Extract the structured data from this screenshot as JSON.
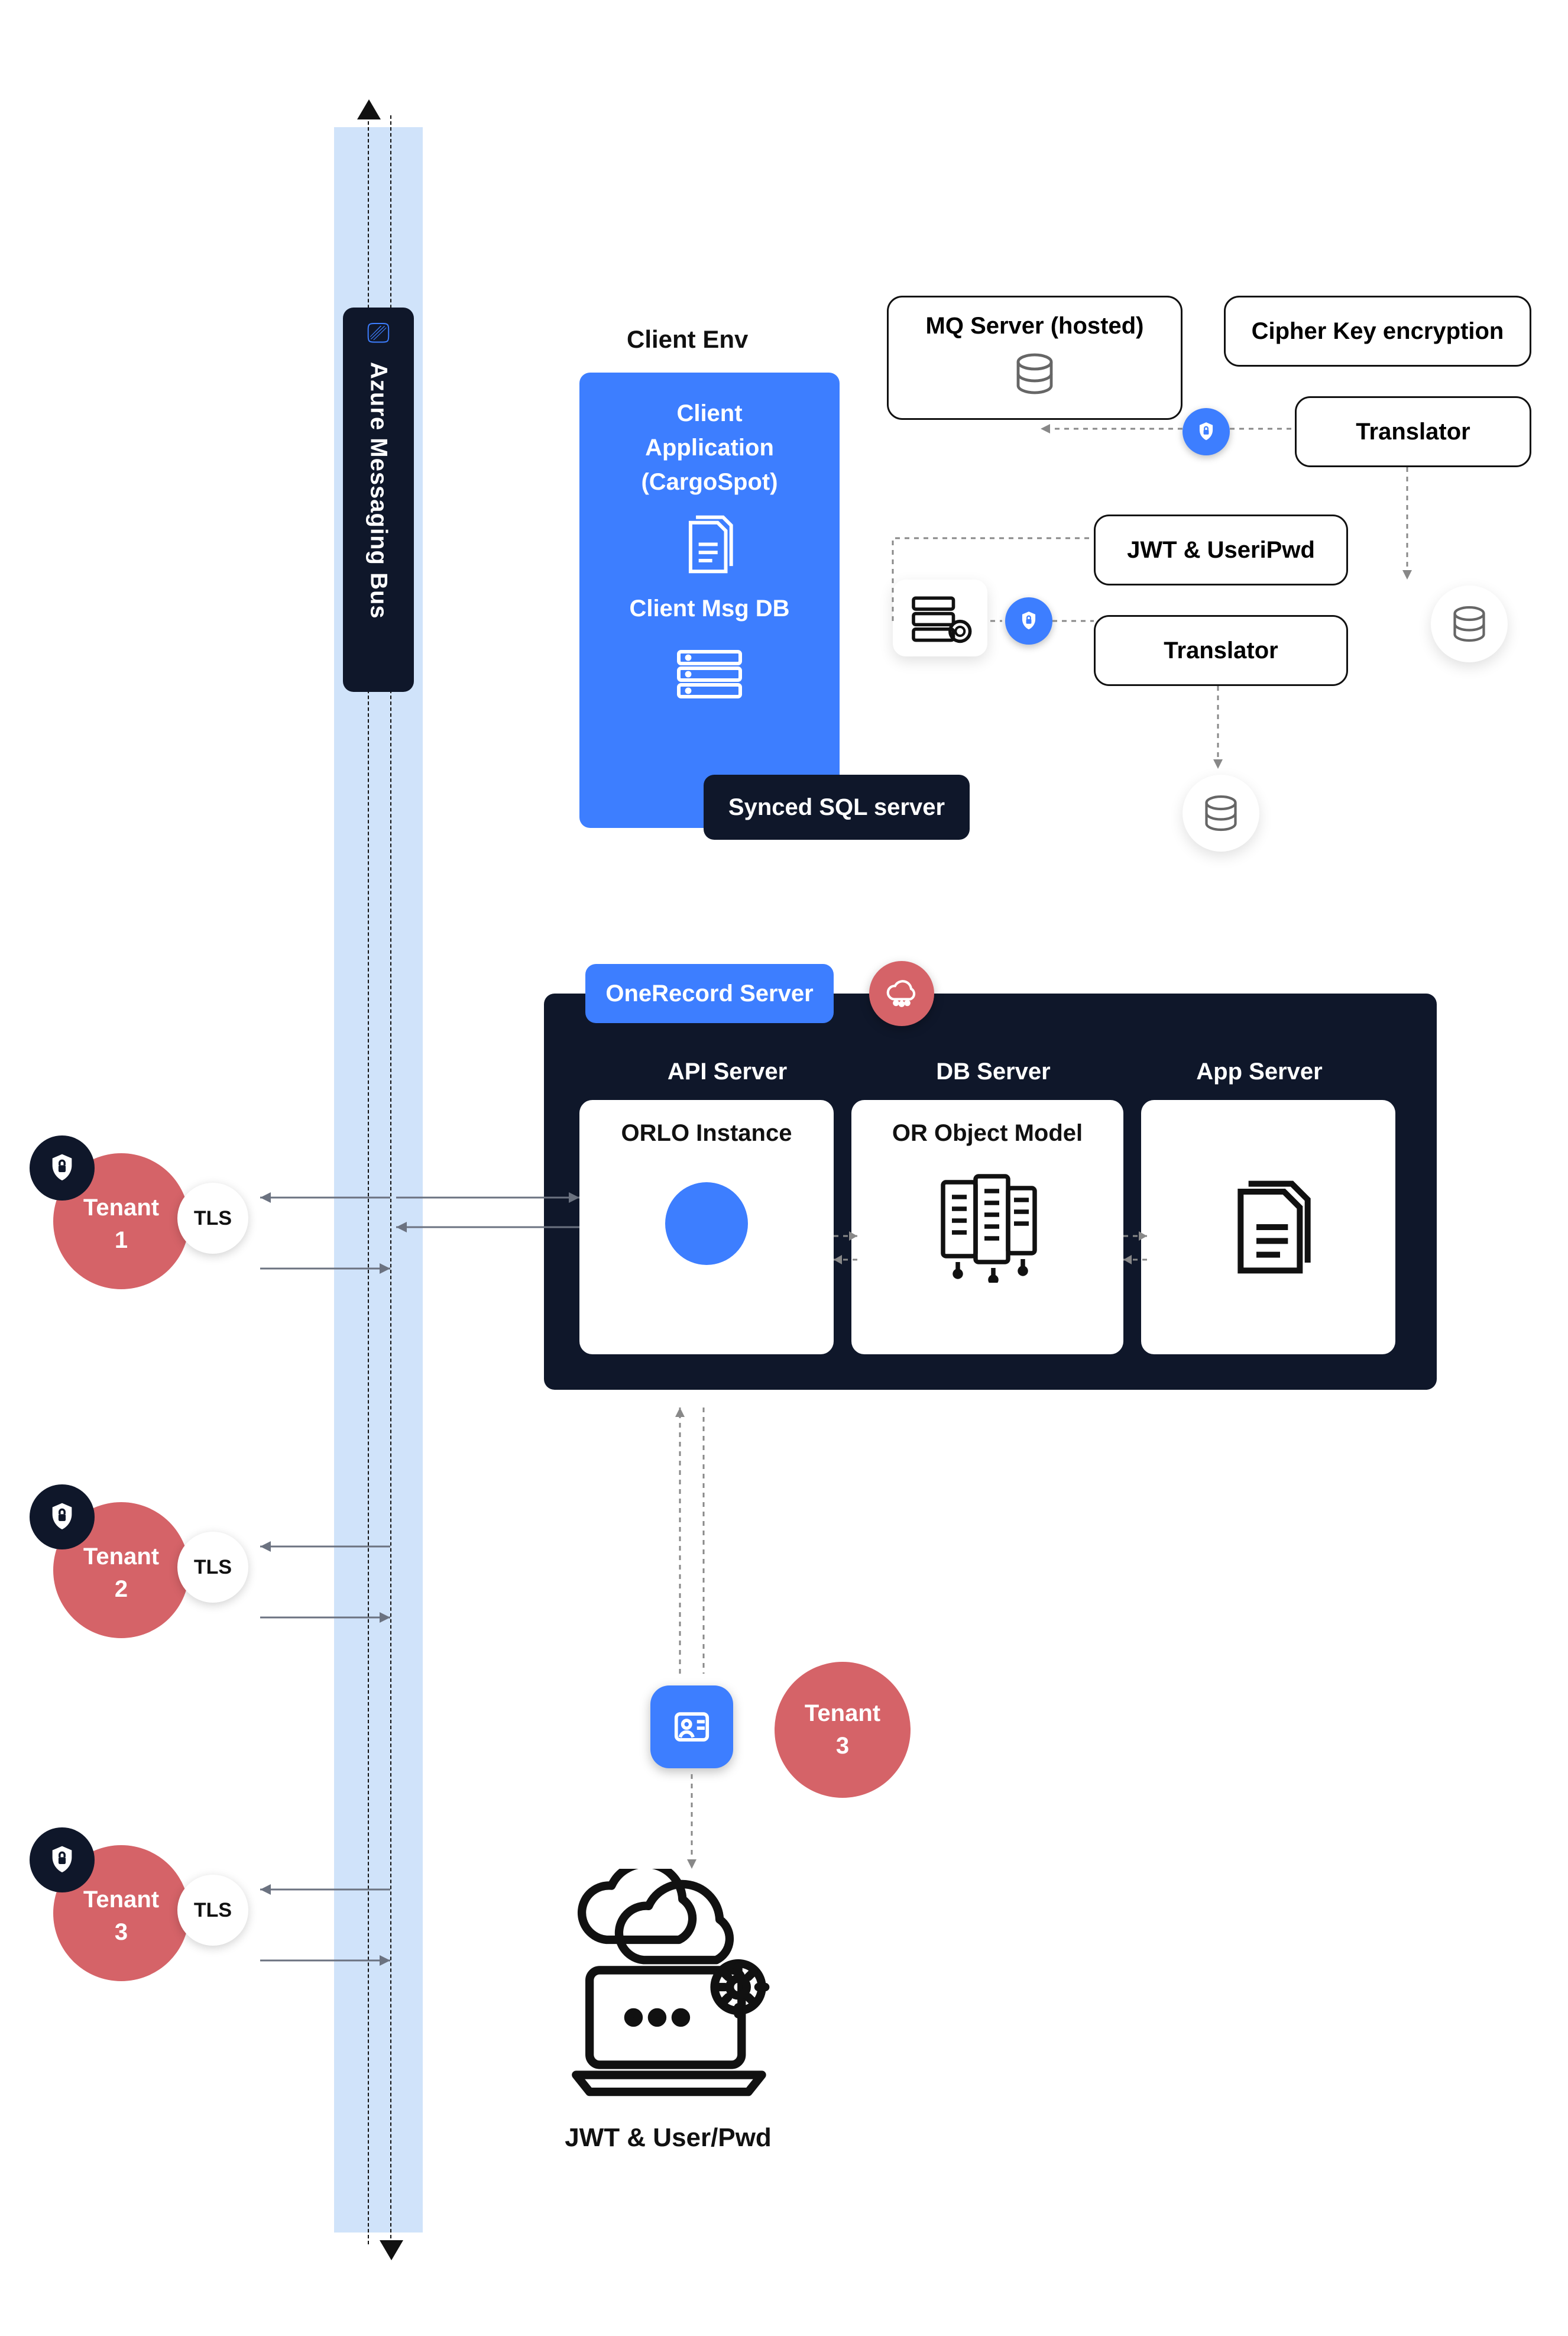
{
  "bus": {
    "title": "Azure Messaging Bus"
  },
  "client": {
    "env_label": "Client Env",
    "app_lines": [
      "Client",
      "Application",
      "(CargoSpot)"
    ],
    "msg_db": "Client Msg DB",
    "synced": "Synced SQL server"
  },
  "right": {
    "mq": "MQ Server (hosted)",
    "cipher": "Cipher Key encryption",
    "jwt_user": "JWT & UseriPwd",
    "translator_1": "Translator",
    "translator_2": "Translator"
  },
  "or": {
    "tab": "OneRecord Server",
    "cols": [
      "API Server",
      "DB Server",
      "App Server"
    ],
    "api_title": "ORLO Instance",
    "db_title": "OR Object Model"
  },
  "tenants": [
    {
      "name": "Tenant",
      "num": "1",
      "tls": "TLS"
    },
    {
      "name": "Tenant",
      "num": "2",
      "tls": "TLS"
    },
    {
      "name": "Tenant",
      "num": "3",
      "tls": "TLS"
    }
  ],
  "bottom": {
    "tenant3_name": "Tenant",
    "tenant3_num": "3",
    "jwt": "JWT & User/Pwd"
  }
}
